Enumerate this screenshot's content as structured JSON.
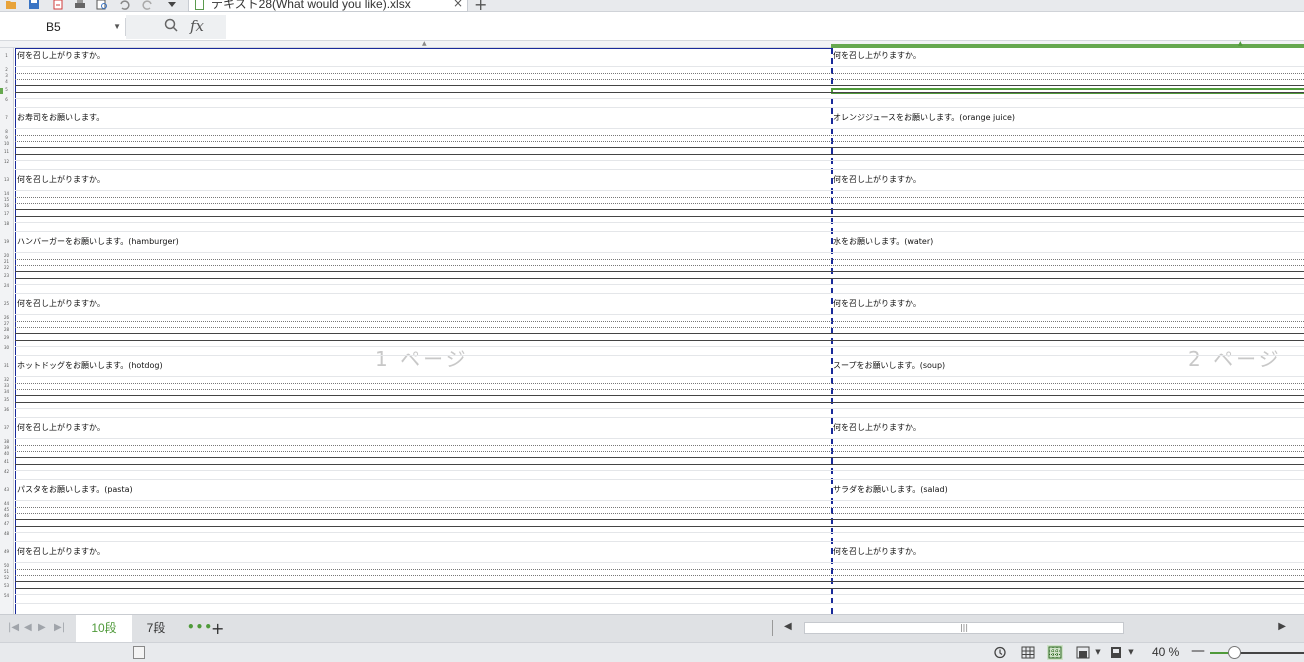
{
  "document": {
    "tab_title": "テキスト28(What would you like).xlsx",
    "close_glyph": "×",
    "new_tab_glyph": "+"
  },
  "formula_bar": {
    "cell_reference": "B5",
    "fx_label": "fx",
    "formula_value": ""
  },
  "sheet": {
    "page_labels": [
      "1 ページ",
      "2 ページ"
    ],
    "rows": [
      {
        "num": "1",
        "left": "何を召し上がりますか。",
        "right": "何を召し上がりますか。"
      },
      {
        "num": "7",
        "left": "お寿司をお願いします。",
        "right": "オレンジジュースをお願いします。(orange juice)"
      },
      {
        "num": "13",
        "left": "何を召し上がりますか。",
        "right": "何を召し上がりますか。"
      },
      {
        "num": "19",
        "left": "ハンバーガーをお願いします。(hamburger)",
        "right": "水をお願いします。(water)"
      },
      {
        "num": "25",
        "left": "何を召し上がりますか。",
        "right": "何を召し上がりますか。"
      },
      {
        "num": "31",
        "left": "ホットドッグをお願いします。(hotdog)",
        "right": "スープをお願いします。(soup)"
      },
      {
        "num": "37",
        "left": "何を召し上がりますか。",
        "right": "何を召し上がりますか。"
      },
      {
        "num": "43",
        "left": "パスタをお願いします。(pasta)",
        "right": "サラダをお願いします。(salad)"
      },
      {
        "num": "49",
        "left": "何を召し上がりますか。",
        "right": "何を召し上がりますか。"
      }
    ],
    "minor_row_numbers": [
      "2",
      "3",
      "4",
      "5",
      "6",
      "8",
      "9",
      "10",
      "11",
      "12",
      "14",
      "15",
      "16",
      "17",
      "18",
      "20",
      "21",
      "22",
      "23",
      "24",
      "26",
      "27",
      "28",
      "29",
      "30",
      "32",
      "33",
      "34",
      "35",
      "36",
      "38",
      "39",
      "40",
      "41",
      "42",
      "44",
      "45",
      "46",
      "47",
      "48",
      "50",
      "51",
      "52",
      "53",
      "54"
    ]
  },
  "tabs": {
    "sheets": [
      "10段",
      "7段"
    ],
    "active": "10段",
    "more_glyph": "•••",
    "add_glyph": "+",
    "scroll_thumb_glyph": "|||"
  },
  "status": {
    "zoom_label": "40 %",
    "zoom_fraction": 0.25,
    "zoom_minus": "—",
    "icons": [
      "history-icon",
      "normal-view-icon",
      "page-break-view-icon",
      "page-layout-icon",
      "reading-mode-icon"
    ]
  }
}
